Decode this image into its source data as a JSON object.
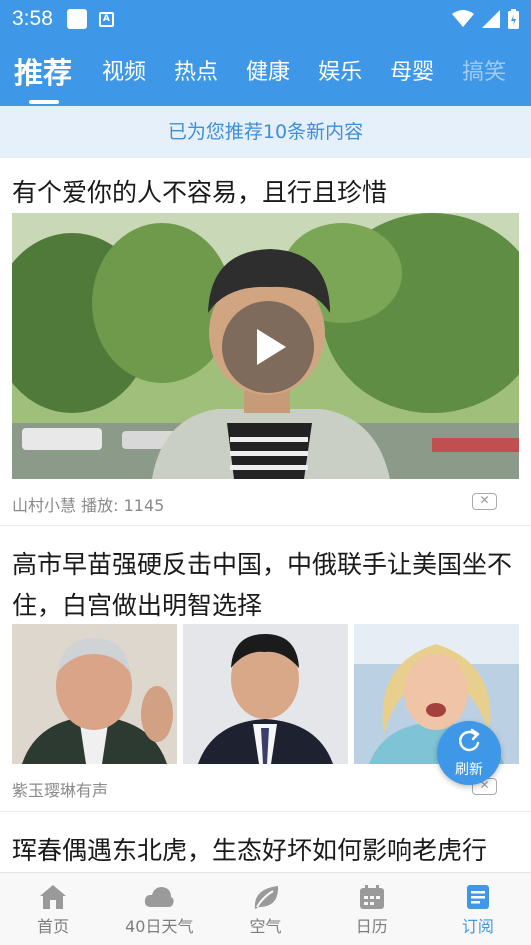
{
  "status_bar": {
    "time": "3:58",
    "a_icon": "A"
  },
  "tabs": [
    {
      "label": "推荐",
      "active": true
    },
    {
      "label": "视频"
    },
    {
      "label": "热点"
    },
    {
      "label": "健康"
    },
    {
      "label": "娱乐"
    },
    {
      "label": "母婴"
    },
    {
      "label": "搞笑"
    }
  ],
  "notice": "已为您推荐10条新内容",
  "articles": [
    {
      "title": "有个爱你的人不容易，且行且珍惜",
      "source": "山村小慧",
      "plays": "播放: 1145",
      "dismiss": "✕"
    },
    {
      "title": "高市早苗强硬反击中国，中俄联手让美国坐不住，白宫做出明智选择",
      "source": "紫玉璎琳有声",
      "dismiss": "✕"
    },
    {
      "title": "珲春偶遇东北虎，生态好坏如何影响老虎行"
    }
  ],
  "fab": {
    "label": "刷新",
    "icon": "refresh-icon"
  },
  "bottom_nav": [
    {
      "label": "首页",
      "icon": "home-icon"
    },
    {
      "label": "40日天气",
      "icon": "cloud-icon"
    },
    {
      "label": "空气",
      "icon": "leaf-icon"
    },
    {
      "label": "日历",
      "icon": "calendar-icon"
    },
    {
      "label": "订阅",
      "icon": "news-icon",
      "active": true
    }
  ],
  "colors": {
    "primary": "#3f97e8",
    "notice_bg": "#e5f0fb",
    "notice_text": "#3f8ed8"
  }
}
